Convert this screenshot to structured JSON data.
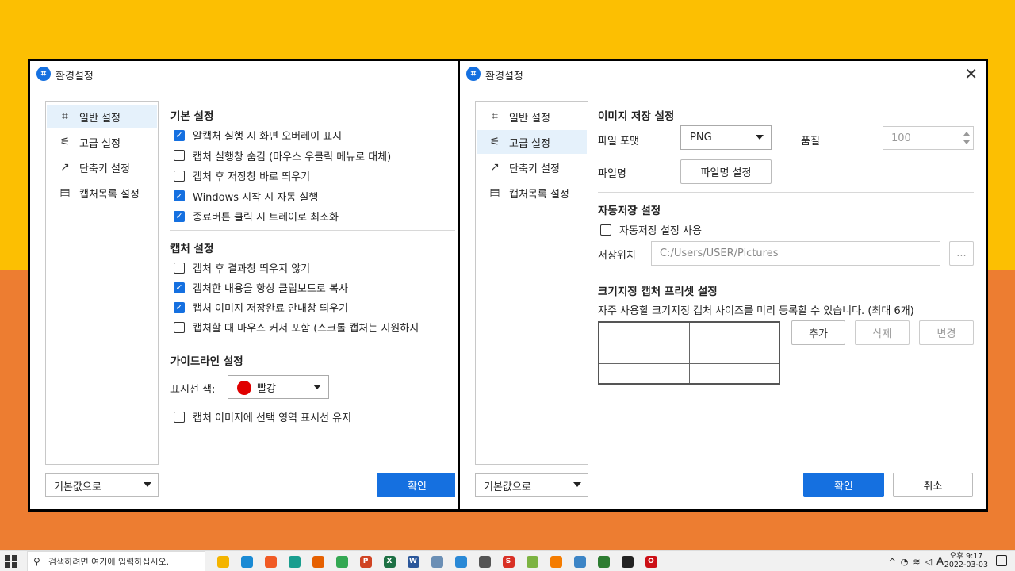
{
  "colors": {
    "bg_top": "#fcbf02",
    "bg_bottom": "#ed7d31",
    "accent": "#1570e0",
    "selected_nav": "#e5f1fb",
    "red_swatch": "#e00000"
  },
  "left_window": {
    "title": "환경설정",
    "nav": [
      {
        "label": "일반 설정",
        "icon": "crop-icon",
        "glyph": "⌗",
        "active": true
      },
      {
        "label": "고급 설정",
        "icon": "sliders-icon",
        "glyph": "⚟",
        "active": false
      },
      {
        "label": "단축키 설정",
        "icon": "shortcut-arrow-icon",
        "glyph": "↗",
        "active": false
      },
      {
        "label": "캡처목록 설정",
        "icon": "list-frame-icon",
        "glyph": "▤",
        "active": false
      }
    ],
    "basic_section": {
      "title": "기본 설정",
      "options": [
        {
          "label": "알캡처 실행 시 화면 오버레이 표시",
          "checked": true
        },
        {
          "label": "캡처 실행창 숨김 (마우스 우클릭 메뉴로 대체)",
          "checked": false
        },
        {
          "label": "캡처 후 저장창 바로 띄우기",
          "checked": false
        },
        {
          "label": "Windows 시작 시 자동 실행",
          "checked": true
        },
        {
          "label": "종료버튼 클릭 시 트레이로 최소화",
          "checked": true
        }
      ]
    },
    "capture_section": {
      "title": "캡처 설정",
      "options": [
        {
          "label": "캡처 후 결과창 띄우지 않기",
          "checked": false
        },
        {
          "label": "캡처한 내용을 항상 클립보드로 복사",
          "checked": true
        },
        {
          "label": "캡처 이미지 저장완료 안내창 띄우기",
          "checked": true
        },
        {
          "label": "캡처할 때 마우스 커서 포함 (스크롤 캡처는 지원하지",
          "checked": false
        }
      ]
    },
    "guide_section": {
      "title": "가이드라인 설정",
      "color_label": "표시선 색:",
      "color_value": "빨강",
      "keep_option": {
        "label": "캡처 이미지에 선택 영역 표시선 유지",
        "checked": false
      }
    },
    "default_select": "기본값으로",
    "ok_button": "확인"
  },
  "right_window": {
    "title": "환경설정",
    "nav": [
      {
        "label": "일반 설정",
        "icon": "crop-icon",
        "glyph": "⌗",
        "active": false
      },
      {
        "label": "고급 설정",
        "icon": "sliders-icon",
        "glyph": "⚟",
        "active": true
      },
      {
        "label": "단축키 설정",
        "icon": "shortcut-arrow-icon",
        "glyph": "↗",
        "active": false
      },
      {
        "label": "캡처목록 설정",
        "icon": "list-frame-icon",
        "glyph": "▤",
        "active": false
      }
    ],
    "image_save": {
      "title": "이미지 저장 설정",
      "format_label": "파일 포맷",
      "format_value": "PNG",
      "quality_label": "품질",
      "quality_value": "100",
      "filename_label": "파일명",
      "filename_button": "파일명 설정"
    },
    "auto_save": {
      "title": "자동저장 설정",
      "use_option": {
        "label": "자동저장 설정 사용",
        "checked": false
      },
      "location_label": "저장위치",
      "location_value": "C:/Users/USER/Pictures",
      "browse_button": "..."
    },
    "preset": {
      "title": "크기지정 캡처 프리셋 설정",
      "description": "자주 사용할 크기지정 캡처 사이즈를 미리 등록할 수 있습니다. (최대 6개)",
      "add_button": "추가",
      "delete_button": "삭제",
      "edit_button": "변경"
    },
    "default_select": "기본값으로",
    "ok_button": "확인",
    "cancel_button": "취소"
  },
  "taskbar": {
    "search_placeholder": "검색하려면 여기에 입력하십시오.",
    "apps": [
      {
        "name": "file-explorer-icon",
        "color": "#f4b400",
        "glyph": ""
      },
      {
        "name": "edge-icon",
        "color": "#1a8ad4",
        "glyph": ""
      },
      {
        "name": "brave-icon",
        "color": "#f15a24",
        "glyph": ""
      },
      {
        "name": "app-icon",
        "color": "#1a9e8f",
        "glyph": ""
      },
      {
        "name": "firefox-icon",
        "color": "#e66000",
        "glyph": ""
      },
      {
        "name": "chrome-icon",
        "color": "#34a853",
        "glyph": ""
      },
      {
        "name": "powerpoint-icon",
        "color": "#d04423",
        "glyph": "P"
      },
      {
        "name": "excel-icon",
        "color": "#1e7145",
        "glyph": "X"
      },
      {
        "name": "word-icon",
        "color": "#2b579a",
        "glyph": "W"
      },
      {
        "name": "app-icon",
        "color": "#6b8fb5",
        "glyph": ""
      },
      {
        "name": "app-icon",
        "color": "#2a89d6",
        "glyph": ""
      },
      {
        "name": "app-icon",
        "color": "#555555",
        "glyph": ""
      },
      {
        "name": "app-icon",
        "color": "#d93025",
        "glyph": "S"
      },
      {
        "name": "app-icon",
        "color": "#7cb342",
        "glyph": ""
      },
      {
        "name": "vlc-icon",
        "color": "#f57c00",
        "glyph": ""
      },
      {
        "name": "app-icon",
        "color": "#3d85c6",
        "glyph": ""
      },
      {
        "name": "app-icon",
        "color": "#2e7d32",
        "glyph": ""
      },
      {
        "name": "app-icon",
        "color": "#222222",
        "glyph": ""
      },
      {
        "name": "opera-icon",
        "color": "#cc0f16",
        "glyph": "O"
      }
    ],
    "tray_lang": "A",
    "time": "오후 9:17",
    "date": "2022-03-03"
  }
}
